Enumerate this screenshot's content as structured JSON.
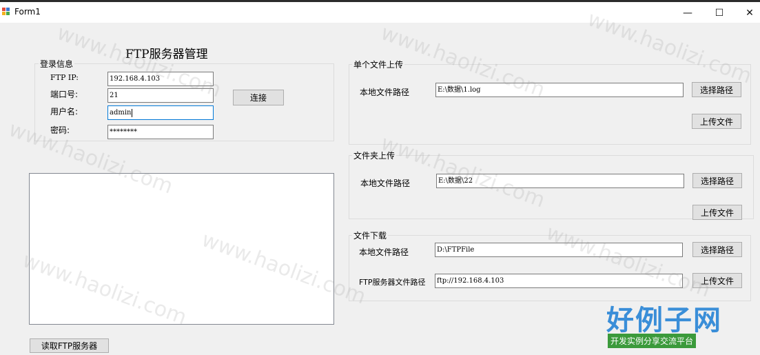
{
  "window": {
    "title": "Form1",
    "minimize_glyph": "—",
    "maximize_glyph": "☐",
    "close_glyph": "✕"
  },
  "form_title": "FTP服务器管理",
  "login": {
    "group_title": "登录信息",
    "ftp_ip_label": "FTP IP:",
    "ftp_ip_value": "192.168.4.103",
    "port_label": "端口号:",
    "port_value": "21",
    "user_label": "用户名:",
    "user_value": "admin",
    "password_label": "密码:",
    "password_value": "********",
    "connect_button": "连接"
  },
  "read_server_button": "读取FTP服务器",
  "single_upload": {
    "group_title": "单个文件上传",
    "local_path_label": "本地文件路径",
    "local_path_value": "E:\\数据\\1.log",
    "choose_button": "选择路径",
    "upload_button": "上传文件"
  },
  "folder_upload": {
    "group_title": "文件夹上传",
    "local_path_label": "本地文件路径",
    "local_path_value": "E:\\数据\\22",
    "choose_button": "选择路径",
    "upload_button": "上传文件"
  },
  "download": {
    "group_title": "文件下载",
    "local_path_label": "本地文件路径",
    "local_path_value": "D:\\FTPFile",
    "choose_button": "选择路径",
    "server_path_label": "FTP服务器文件路径",
    "server_path_value": "ftp://192.168.4.103",
    "download_button": "上传文件"
  },
  "watermark": {
    "text": "www.haolizi.com",
    "logo_main": "好例子网",
    "logo_sub": "开发实例分享交流平台"
  },
  "colors": {
    "focus_border": "#0078d7",
    "logo_blue": "#3a8ed8",
    "logo_green": "#3b9a3b"
  }
}
